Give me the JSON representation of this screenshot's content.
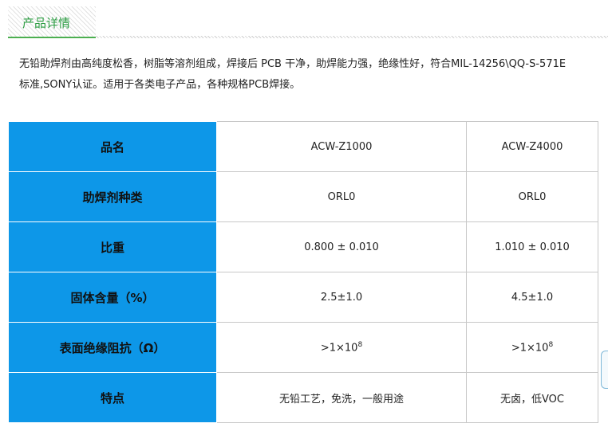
{
  "section": {
    "title": "产品详情"
  },
  "description": {
    "line1": "无铅助焊剂由高纯度松香，树脂等溶剂组成，焊接后 PCB 干净，助焊能力强，绝缘性好，符合MIL-14256\\QQ-S-571E",
    "line2": "标准,SONY认证。适用于各类电子产品，各种规格PCB焊接。"
  },
  "table": {
    "rows": [
      {
        "label": "品名",
        "col1": "ACW-Z1000",
        "col2": "ACW-Z4000"
      },
      {
        "label": "助焊剂种类",
        "col1": "ORL0",
        "col2": "ORL0"
      },
      {
        "label": "比重",
        "col1": "0.800 ± 0.010",
        "col2": "1.010 ± 0.010"
      },
      {
        "label": "固体含量（%）",
        "col1": "2.5±1.0",
        "col2": "4.5±1.0"
      },
      {
        "label": "表面绝缘阻抗（Ω）",
        "col1_base": ">1×10",
        "col1_exp": "8",
        "col2_base": ">1×10",
        "col2_exp": "8"
      },
      {
        "label": "特点",
        "col1": "无铅工艺，免洗，一般用途",
        "col2": "无卤，低VOC"
      }
    ]
  },
  "colors": {
    "label_bg": "#0d97e8",
    "title_green": "#2e9e44"
  }
}
